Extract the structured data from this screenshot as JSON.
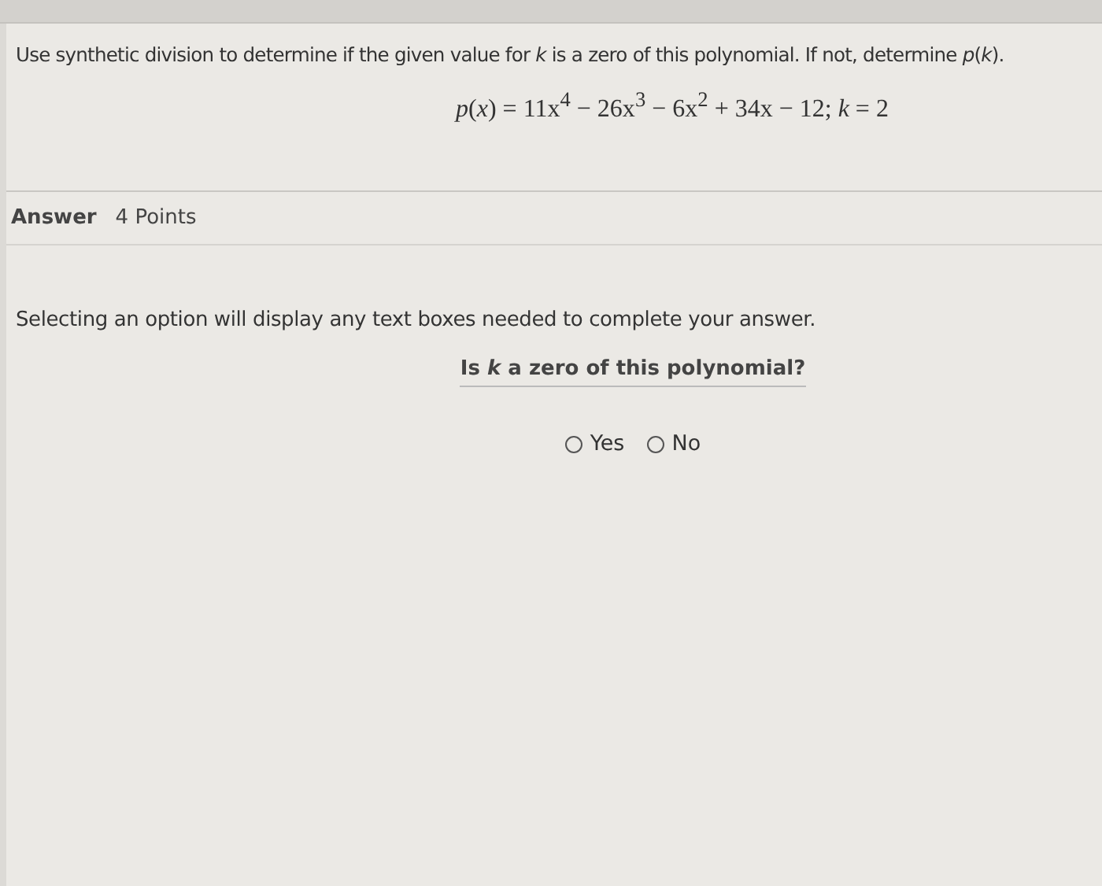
{
  "question": {
    "prompt": "Use synthetic division to determine if the given value for *k* is a zero of this polynomial. If not, determine *p*(*k*).",
    "equation": "*p*(*x*) = 11x$^{4}$ − 26x$^{3}$ − 6x$^{2}$ + 34x − 12; *k* = 2"
  },
  "answer": {
    "label": "Answer",
    "points": "4 Points",
    "instruction": "Selecting an option will display any text boxes needed to complete your answer.",
    "question": "Is *k* a zero of this polynomial?",
    "options": [
      {
        "label": "Yes",
        "selected": false
      },
      {
        "label": "No",
        "selected": false
      }
    ]
  }
}
